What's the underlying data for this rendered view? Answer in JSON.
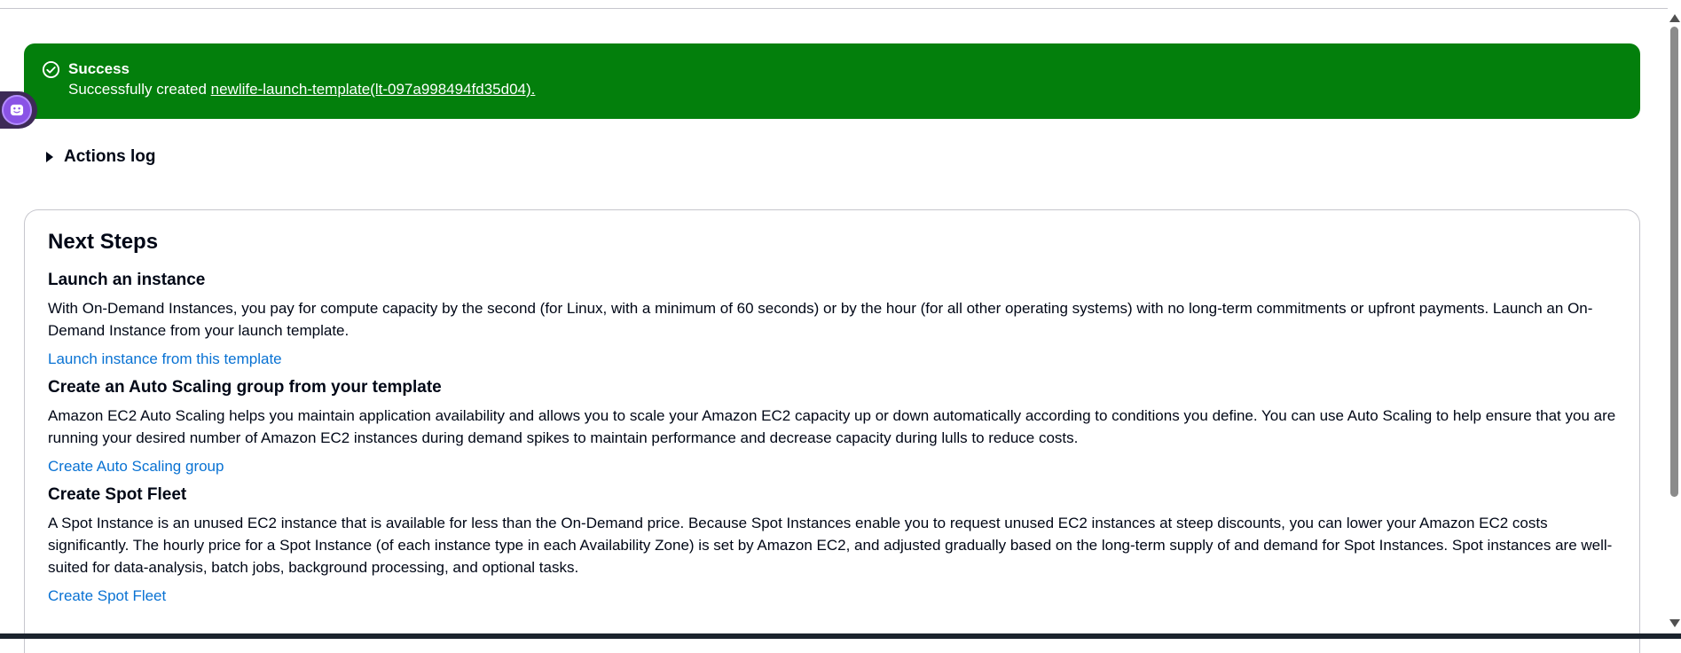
{
  "flash": {
    "header": "Success",
    "message_prefix": "Successfully created ",
    "link_text": "newlife-launch-template(lt-097a998494fd35d04).",
    "color": "#037f0c"
  },
  "actions_log": {
    "label": "Actions log"
  },
  "next_steps": {
    "title": "Next Steps",
    "steps": [
      {
        "title": "Launch an instance",
        "description": "With On-Demand Instances, you pay for compute capacity by the second (for Linux, with a minimum of 60 seconds) or by the hour (for all other operating systems) with no long-term commitments or upfront payments. Launch an On-Demand Instance from your launch template.",
        "link": "Launch instance from this template"
      },
      {
        "title": "Create an Auto Scaling group from your template",
        "description": "Amazon EC2 Auto Scaling helps you maintain application availability and allows you to scale your Amazon EC2 capacity up or down automatically according to conditions you define. You can use Auto Scaling to help ensure that you are running your desired number of Amazon EC2 instances during demand spikes to maintain performance and decrease capacity during lulls to reduce costs.",
        "link": "Create Auto Scaling group"
      },
      {
        "title": "Create Spot Fleet",
        "description": "A Spot Instance is an unused EC2 instance that is available for less than the On-Demand price. Because Spot Instances enable you to request unused EC2 instances at steep discounts, you can lower your Amazon EC2 costs significantly. The hourly price for a Spot Instance (of each instance type in each Availability Zone) is set by Amazon EC2, and adjusted gradually based on the long-term supply of and demand for Spot Instances. Spot instances are well-suited for data-analysis, batch jobs, background processing, and optional tasks.",
        "link": "Create Spot Fleet"
      }
    ]
  },
  "colors": {
    "link": "#0972d3",
    "text": "#000716",
    "border": "#c6c6cd"
  }
}
